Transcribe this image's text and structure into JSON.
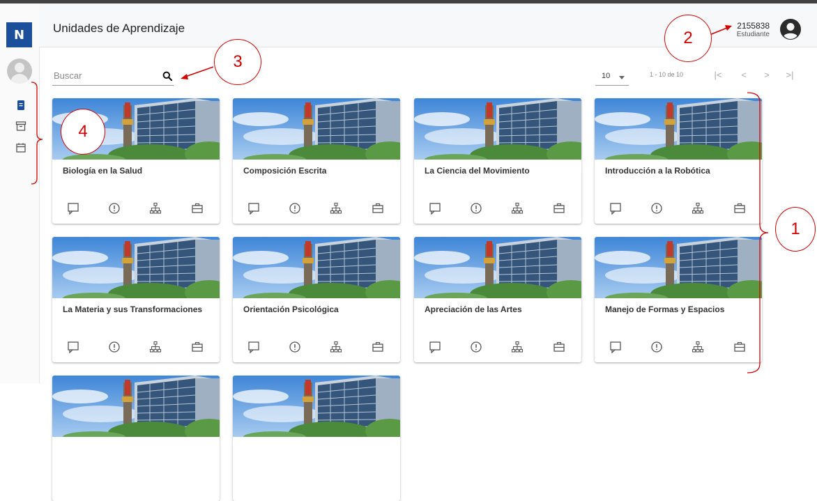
{
  "app": {
    "logo_letter": "N",
    "page_title": "Unidades de Aprendizaje"
  },
  "user": {
    "id": "2155838",
    "role": "Estudiante"
  },
  "search": {
    "placeholder": "Buscar",
    "value": ""
  },
  "pager": {
    "page_size": "10",
    "range": "1 - 10 de 10"
  },
  "courses": [
    {
      "title": "Biología en la Salud"
    },
    {
      "title": "Composición Escrita"
    },
    {
      "title": "La Ciencia del Movimiento"
    },
    {
      "title": "Introducción a la Robótica"
    },
    {
      "title": "La Materia y sus Transformaciones"
    },
    {
      "title": "Orientación Psicológica"
    },
    {
      "title": "Apreciación de las Artes"
    },
    {
      "title": "Manejo de Formas y Espacios"
    }
  ],
  "card_icons": [
    "chat-icon",
    "alert-icon",
    "hierarchy-icon",
    "briefcase-icon"
  ],
  "sidebar_icons": [
    "book-icon",
    "archive-icon",
    "calendar-icon"
  ],
  "annotations": [
    "1",
    "2",
    "3",
    "4"
  ],
  "colors": {
    "brand": "#1b4f9c",
    "annotation": "#d50000",
    "active_icon": "#1b4f9c"
  }
}
